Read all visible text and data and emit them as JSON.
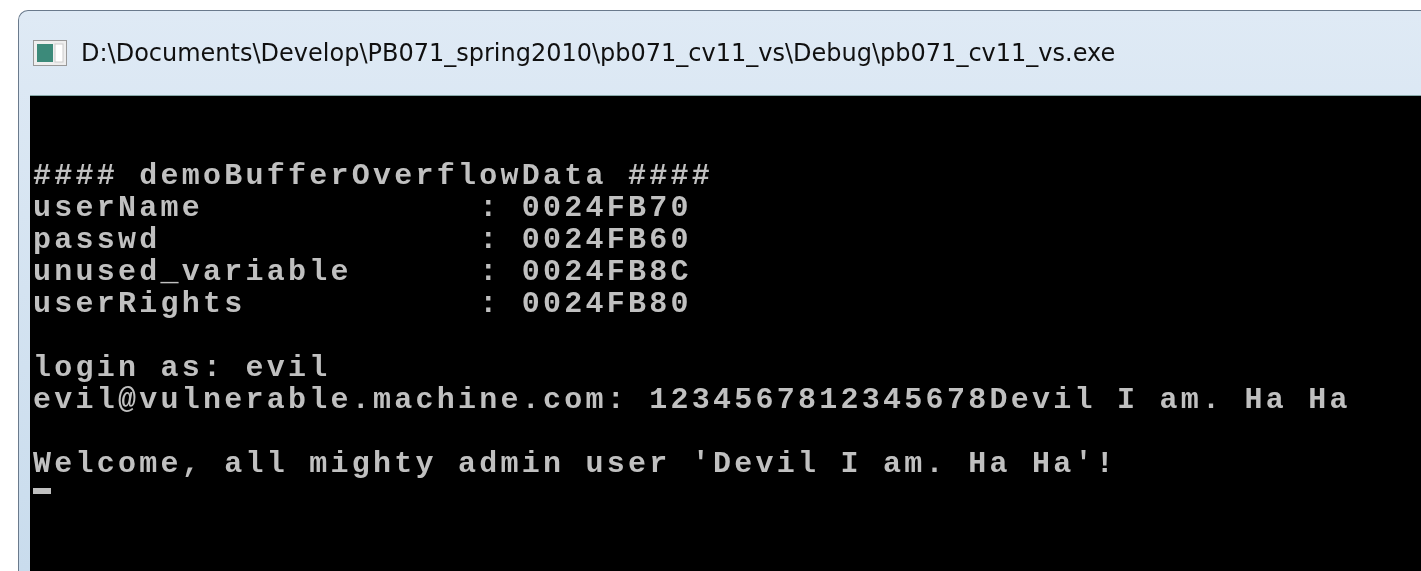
{
  "window": {
    "title": "D:\\Documents\\Develop\\PB071_spring2010\\pb071_cv11_vs\\Debug\\pb071_cv11_vs.exe"
  },
  "console": {
    "blocks": [
      [
        "#### demoBufferOverflowData ####",
        "userName             : 0024FB70",
        "passwd               : 0024FB60",
        "unused_variable      : 0024FB8C",
        "userRights           : 0024FB80"
      ],
      [
        "login as: evil",
        "evil@vulnerable.machine.com: 1234567812345678Devil I am. Ha Ha"
      ],
      [
        "Welcome, all mighty admin user 'Devil I am. Ha Ha'!"
      ]
    ],
    "cursor": true
  }
}
